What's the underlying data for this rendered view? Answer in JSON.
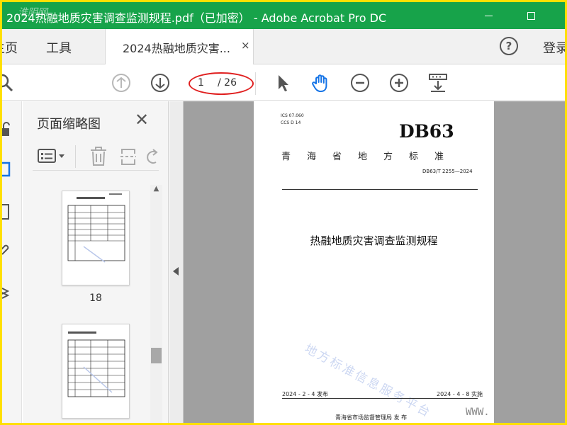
{
  "window": {
    "title": "2024热融地质灾害调查监测规程.pdf（已加密） - Adobe Acrobat Pro DC",
    "watermark": "淮阴网"
  },
  "menubar": {
    "home": "主页",
    "tools": "工具",
    "doc_tab": "2024热融地质灾害...",
    "doc_tab_close": "×",
    "help": "?",
    "login": "登录"
  },
  "toolbar": {
    "page_current": "1",
    "page_total": "/ 26"
  },
  "panel": {
    "title": "页面缩略图",
    "close": "✕",
    "thumbnails": [
      {
        "label": "18"
      },
      {
        "label": ""
      }
    ]
  },
  "document": {
    "ics": "ICS  07.060",
    "ccs": "CCS  D 14",
    "standard_prefix": "DB63",
    "province": "青海省地方标准",
    "code": "DB63/T 2255—2024",
    "title": "热融地质灾害调查监测规程",
    "publish_date": "2024 - 2 - 4 发布",
    "implement_date": "2024 - 4 - 8 实施",
    "issuer": "青海省市场监督管理局     发  布",
    "watermark": "地方标准信息服务平台",
    "corner_text": "WWW."
  },
  "colors": {
    "titlebar": "#17a34a",
    "frame_border": "#ffe000",
    "annotation": "#e02020",
    "hand_tool": "#1473e6"
  }
}
